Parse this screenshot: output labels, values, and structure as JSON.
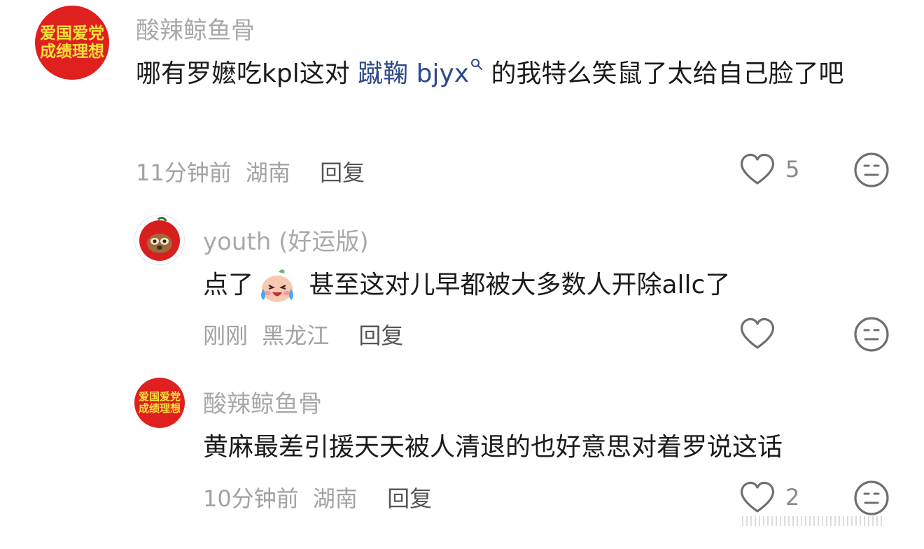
{
  "comments": [
    {
      "avatar_text": [
        "爱国爱党",
        "成绩理想"
      ],
      "username": "酸辣鲸鱼骨",
      "text_before": "哪有罗嬷吃kpl这对 ",
      "mention": "蹴鞠 bjyx",
      "text_after": " 的我特么笑鼠了太给自己脸了吧",
      "time": "11分钟前",
      "location": "湖南",
      "reply": "回复",
      "likes": "5"
    },
    {
      "username": "youth (好运版)",
      "text_before": "点了",
      "text_after": " 甚至这对儿早都被大多数人开除allc了",
      "time": "刚刚",
      "location": "黑龙江",
      "reply": "回复",
      "likes": ""
    },
    {
      "avatar_text": [
        "爱国爱党",
        "成绩理想"
      ],
      "username": "酸辣鲸鱼骨",
      "text": "黄麻最差引援天天被人清退的也好意思对着罗说这话",
      "time": "10分钟前",
      "location": "湖南",
      "reply": "回复",
      "likes": "2"
    }
  ],
  "colors": {
    "avatar_red": "#e01f1f",
    "avatar_text": "#f4e23a",
    "mention": "#2d4a8a"
  },
  "icons": [
    "heart-icon",
    "emoji-neutral-icon",
    "search-icon",
    "crying-laugh-emoji",
    "avatar-dog-icon"
  ]
}
